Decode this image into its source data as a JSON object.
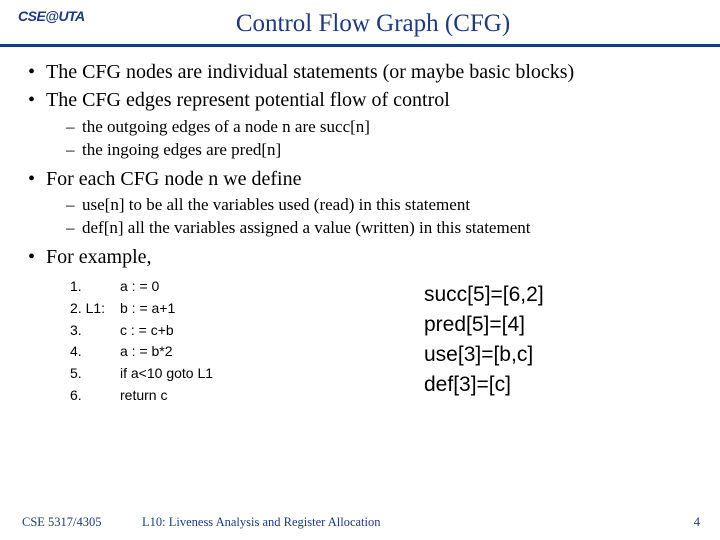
{
  "header": {
    "logo_text": "CSE@UTA",
    "title": "Control Flow Graph (CFG)"
  },
  "bullets": {
    "b1": "The CFG nodes are individual statements (or maybe basic blocks)",
    "b2": "The CFG edges represent potential flow of control",
    "b2_sub1": "the outgoing edges of a node n are succ[n]",
    "b2_sub2": "the ingoing edges are pred[n]",
    "b3": "For each CFG node n we define",
    "b3_sub1": "use[n] to be all the variables used (read) in this statement",
    "b3_sub2": "def[n] all the variables assigned a value (written) in this statement",
    "b4": " For example,"
  },
  "code": [
    {
      "ln": "1.",
      "stmt": "a : = 0"
    },
    {
      "ln": "2. L1:",
      "stmt": "b : = a+1"
    },
    {
      "ln": "3.",
      "stmt": "c : = c+b"
    },
    {
      "ln": "4.",
      "stmt": "a : = b*2"
    },
    {
      "ln": "5.",
      "stmt": "if a<10 goto L1"
    },
    {
      "ln": "6.",
      "stmt": "return c"
    }
  ],
  "results": {
    "r1": "succ[5]=[6,2]",
    "r2": "pred[5]=[4]",
    "r3": "use[3]=[b,c]",
    "r4": "def[3]=[c]"
  },
  "footer": {
    "course": "CSE 5317/4305",
    "lecture": "L10: Liveness Analysis and Register Allocation",
    "page": "4"
  }
}
